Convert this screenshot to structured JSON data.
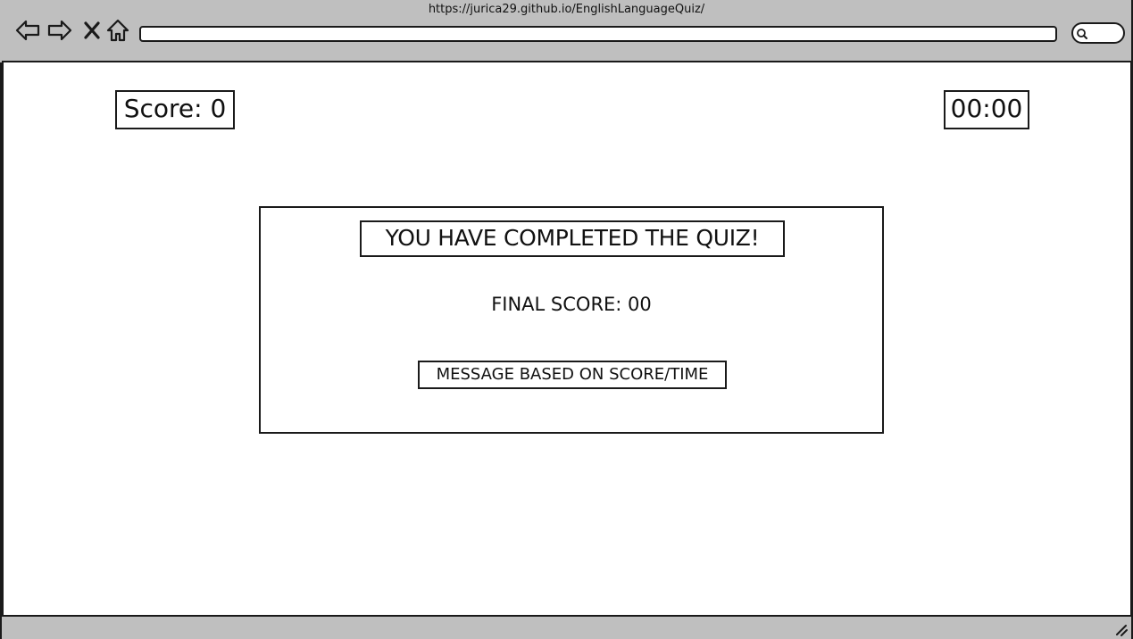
{
  "browser": {
    "url": "https://jurica29.github.io/EnglishLanguageQuiz/",
    "address_value": "",
    "icons": [
      "back-arrow-icon",
      "forward-arrow-icon",
      "close-icon",
      "home-icon",
      "search-icon",
      "resize-grip-icon"
    ]
  },
  "hud": {
    "score_label": "Score: 0",
    "timer": "00:00"
  },
  "result": {
    "title": "YOU HAVE COMPLETED THE QUIZ!",
    "final_score": "FINAL SCORE: 00",
    "message": "MESSAGE BASED ON SCORE/TIME"
  },
  "colors": {
    "chrome": "#bfbfbf",
    "ink": "#1a1a1a",
    "page": "#ffffff"
  }
}
